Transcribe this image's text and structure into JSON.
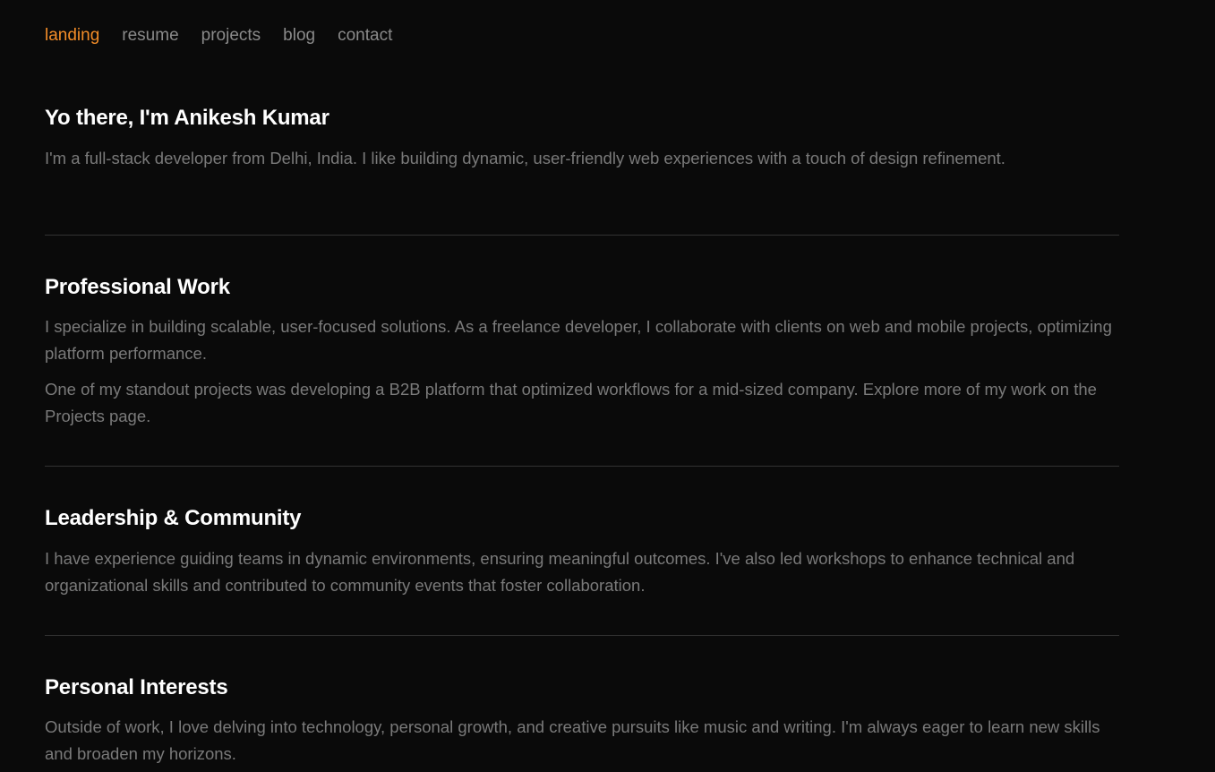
{
  "nav": {
    "items": [
      {
        "label": "landing",
        "active": true
      },
      {
        "label": "resume",
        "active": false
      },
      {
        "label": "projects",
        "active": false
      },
      {
        "label": "blog",
        "active": false
      },
      {
        "label": "contact",
        "active": false
      }
    ]
  },
  "colors": {
    "background": "#0a0a0a",
    "accent": "#f28c28",
    "heading": "#ffffff",
    "body_text": "#7a7a7a",
    "nav_text": "#8a8a8a",
    "divider": "#333333"
  },
  "intro": {
    "title": "Yo there, I'm Anikesh Kumar",
    "body": "I'm a full-stack developer from Delhi, India. I like building dynamic, user-friendly web experiences with a touch of design refinement."
  },
  "professional": {
    "title": "Professional Work",
    "paragraphs": [
      "I specialize in building scalable, user-focused solutions. As a freelance developer, I collaborate with clients on web and mobile projects, optimizing platform performance.",
      "One of my standout projects was developing a B2B platform that optimized workflows for a mid-sized company. Explore more of my work on the Projects page."
    ]
  },
  "leadership": {
    "title": "Leadership & Community",
    "body": "I have experience guiding teams in dynamic environments, ensuring meaningful outcomes. I've also led workshops to enhance technical and organizational skills and contributed to community events that foster collaboration."
  },
  "interests": {
    "title": "Personal Interests",
    "body": "Outside of work, I love delving into technology, personal growth, and creative pursuits like music and writing. I'm always eager to learn new skills and broaden my horizons."
  }
}
